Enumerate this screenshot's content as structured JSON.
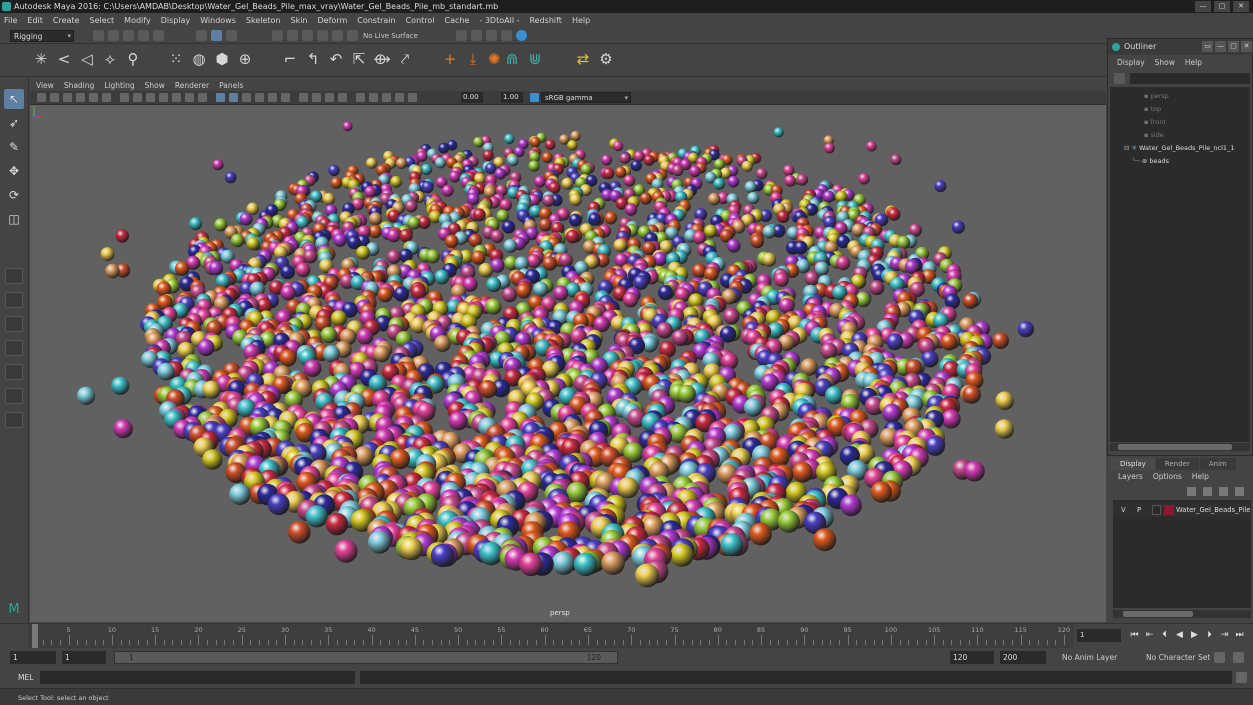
{
  "window": {
    "title": "Autodesk Maya 2016: C:\\Users\\AMDAB\\Desktop\\Water_Gel_Beads_Pile_max_vray\\Water_Gel_Beads_Pile_mb_standart.mb",
    "minimize": "—",
    "maximize": "▢",
    "close": "✕"
  },
  "menubar": [
    "File",
    "Edit",
    "Create",
    "Select",
    "Modify",
    "Display",
    "Windows",
    "Skeleton",
    "Skin",
    "Deform",
    "Constrain",
    "Control",
    "Cache",
    "- 3DtoAll -",
    "Redshift",
    "Help"
  ],
  "statusline": {
    "menuset": "Rigging",
    "live_surface": "No Live Surface"
  },
  "panel": {
    "menu": [
      "View",
      "Shading",
      "Lighting",
      "Show",
      "Renderer",
      "Panels"
    ],
    "exposure": "0.00",
    "gamma": "1.00",
    "color_space": "sRGB gamma",
    "camera_label": "persp"
  },
  "outliner": {
    "title": "Outliner",
    "menu": [
      "Display",
      "Show",
      "Help"
    ],
    "items": [
      {
        "label": "persp",
        "dim": true
      },
      {
        "label": "top",
        "dim": true
      },
      {
        "label": "front",
        "dim": true
      },
      {
        "label": "side",
        "dim": true
      },
      {
        "label": "Water_Gel_Beads_Pile_ncl1_1",
        "dim": false
      },
      {
        "label": "beads",
        "dim": false
      }
    ]
  },
  "layers": {
    "tabs": [
      "Display",
      "Render",
      "Anim"
    ],
    "menu": [
      "Layers",
      "Options",
      "Help"
    ],
    "row": {
      "v": "V",
      "p": "P",
      "name": "Water_Gel_Beads_Pile",
      "color": "#8b1a2b"
    }
  },
  "timeline": {
    "ticks": [
      "1",
      "5",
      "10",
      "15",
      "20",
      "25",
      "30",
      "35",
      "40",
      "45",
      "50",
      "55",
      "60",
      "65",
      "70",
      "75",
      "80",
      "85",
      "90",
      "95",
      "100",
      "105",
      "110",
      "115",
      "120"
    ],
    "current_frame": "1"
  },
  "range": {
    "start": "1",
    "playback_start": "1",
    "slider_start": "1",
    "slider_end": "120",
    "playback_end": "120",
    "end": "200",
    "anim_layer": "No Anim Layer",
    "character_set": "No Character Set"
  },
  "cmdline": {
    "label": "MEL"
  },
  "helpline": {
    "text": "Select Tool: select an object"
  },
  "colors": {
    "beads": [
      "#d63ab5",
      "#e6429b",
      "#3fc6cf",
      "#4a3fc4",
      "#d8cc22",
      "#d2502a",
      "#c84a8c",
      "#e0a060",
      "#b43ad4",
      "#cc2a40",
      "#7fd0e0",
      "#f0d050",
      "#2c2a9c",
      "#e05a1e",
      "#9acf3a"
    ]
  }
}
